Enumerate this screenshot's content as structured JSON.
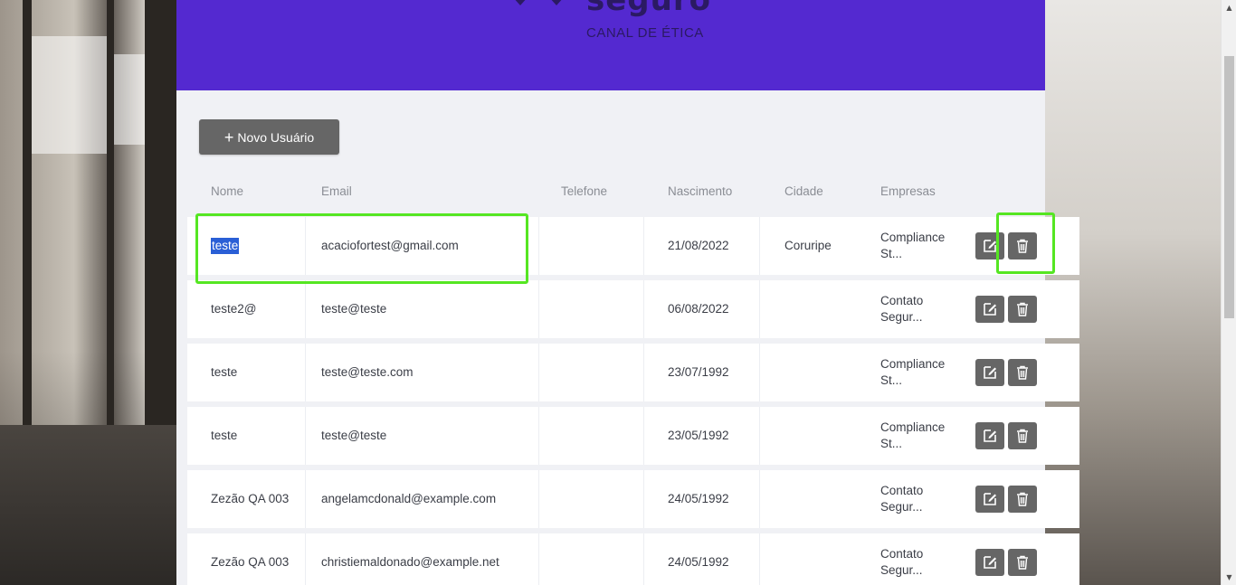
{
  "header": {
    "logo_word": "seguro",
    "logo_subtitle": "CANAL DE ÉTICA",
    "brand_color": "#5429d0"
  },
  "toolbar": {
    "new_user_icon": "plus-icon",
    "new_user_label": "Novo Usuário"
  },
  "table": {
    "columns": {
      "nome": "Nome",
      "email": "Email",
      "telefone": "Telefone",
      "nascimento": "Nascimento",
      "cidade": "Cidade",
      "empresas": "Empresas"
    },
    "rows": [
      {
        "nome": "teste",
        "email": "acaciofortest@gmail.com",
        "telefone": "",
        "nascimento": "21/08/2022",
        "cidade": "Coruripe",
        "empresas": "Compliance St..."
      },
      {
        "nome": "teste2@",
        "email": "teste@teste",
        "telefone": "",
        "nascimento": "06/08/2022",
        "cidade": "",
        "empresas": "Contato Segur..."
      },
      {
        "nome": "teste",
        "email": "teste@teste.com",
        "telefone": "",
        "nascimento": "23/07/1992",
        "cidade": "",
        "empresas": "Compliance St..."
      },
      {
        "nome": "teste",
        "email": "teste@teste",
        "telefone": "",
        "nascimento": "23/05/1992",
        "cidade": "",
        "empresas": "Compliance St..."
      },
      {
        "nome": "Zezão QA 003",
        "email": "angelamcdonald@example.com",
        "telefone": "",
        "nascimento": "24/05/1992",
        "cidade": "",
        "empresas": "Contato Segur..."
      },
      {
        "nome": "Zezão QA 003",
        "email": "christiemaldonado@example.net",
        "telefone": "",
        "nascimento": "24/05/1992",
        "cidade": "",
        "empresas": "Contato Segur..."
      }
    ],
    "row_actions": {
      "edit_icon": "edit-icon",
      "delete_icon": "trash-icon"
    }
  },
  "highlight_color": "#55e622"
}
